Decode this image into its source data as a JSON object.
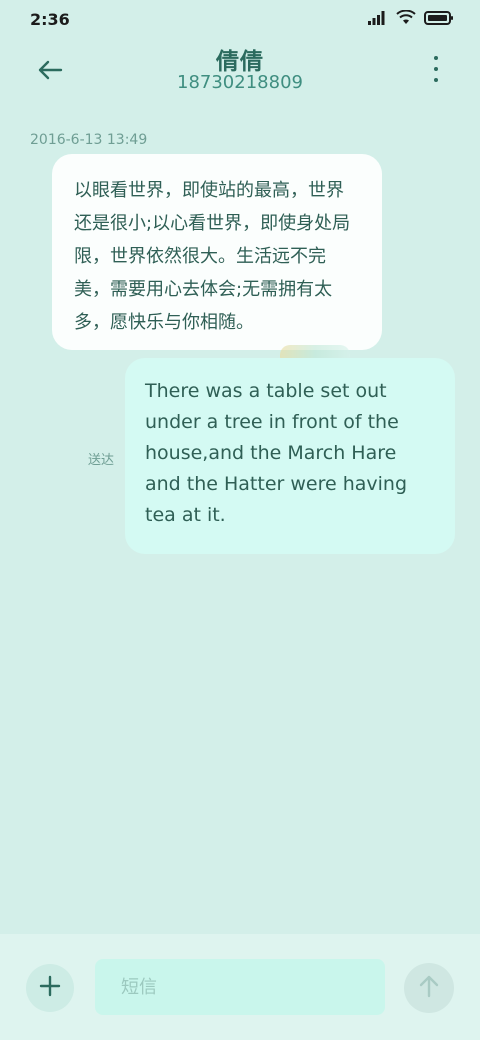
{
  "status_bar": {
    "time": "2:36",
    "icons": [
      "signal-icon",
      "wifi-icon",
      "battery-icon"
    ]
  },
  "header": {
    "contact_name": "倩倩",
    "phone_number": "18730218809",
    "back_icon": "arrow-left-icon",
    "menu_icon": "more-vertical-icon"
  },
  "conversation": {
    "timestamp": "2016-6-13 13:49",
    "messages": [
      {
        "direction": "incoming",
        "text": "以眼看世界，即使站的最高，世界还是很小;以心看世界，即使身处局限，世界依然很大。生活远不完美，需要用心去体会;无需拥有太多，愿快乐与你相随。"
      },
      {
        "direction": "outgoing",
        "text": "There was a table set out under a tree in front of the house,and the March Hare and the Hatter were having tea at it."
      }
    ],
    "delivery_status": "送达"
  },
  "composer": {
    "placeholder": "短信",
    "value": "",
    "add_icon": "plus-icon",
    "send_icon": "arrow-up-icon"
  },
  "colors": {
    "background": "#d3efe9",
    "incoming_bubble": "#fbfefd",
    "outgoing_bubble": "#d4faf3",
    "accent": "#2b6b5e"
  }
}
